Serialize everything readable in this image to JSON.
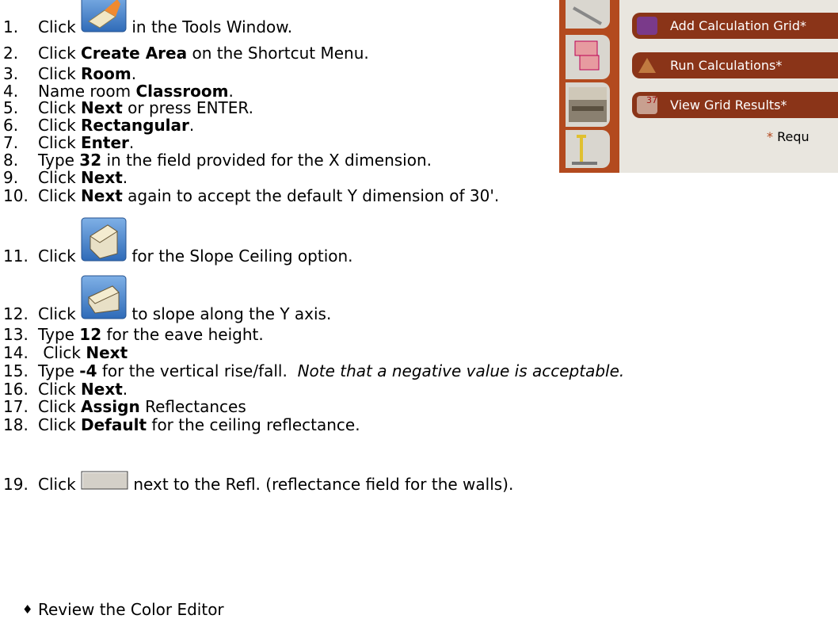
{
  "panel": {
    "buttons": [
      "Add Calculation Grid*",
      "Run Calculations*",
      "View Grid Results*"
    ],
    "grid_badge": "37",
    "required_star": "*",
    "required_text": "Requ"
  },
  "steps": [
    {
      "num": "1.",
      "pre": "Click ",
      "icon": "create-area-tool-icon",
      "post": " in the Tools Window."
    },
    {
      "num": "2.",
      "pre": "Click ",
      "bold": "Create Area",
      "post": " on the Shortcut Menu."
    },
    {
      "num": "3.",
      "pre": "Click ",
      "bold": "Room",
      "post": "."
    },
    {
      "num": "4.",
      "pre": "Name room ",
      "bold": "Classroom",
      "post": "."
    },
    {
      "num": "5.",
      "pre": "Click ",
      "bold": "Next",
      "post": " or press ENTER."
    },
    {
      "num": "6.",
      "pre": "Click ",
      "bold": "Rectangular",
      "post": "."
    },
    {
      "num": "7.",
      "pre": "Click ",
      "bold": "Enter",
      "post": "."
    },
    {
      "num": "8.",
      "pre": "Type ",
      "bold": "32",
      "post": " in the field provided for the X dimension."
    },
    {
      "num": "9.",
      "pre": "Click ",
      "bold": "Next",
      "post": "."
    },
    {
      "num": "10.",
      "pre": "Click ",
      "bold": "Next",
      "post": " again to accept the default Y dimension of 30'."
    },
    {
      "num": "11.",
      "pre": "Click ",
      "icon": "slope-ceiling-icon",
      "post": " for the Slope Ceiling option."
    },
    {
      "num": "12.",
      "pre": "Click ",
      "icon": "slope-y-axis-icon",
      "post": " to slope along the Y axis."
    },
    {
      "num": "13.",
      "pre": "Type ",
      "bold": "12",
      "post": " for the eave height."
    },
    {
      "num": "14.",
      "pre": " Click ",
      "bold": "Next",
      "post": ""
    },
    {
      "num": "15.",
      "pre": "Type ",
      "bold": "-4",
      "post": " for the vertical rise/fall.  ",
      "italic": "Note that a negative value is acceptable."
    },
    {
      "num": "16.",
      "pre": "Click ",
      "bold": "Next",
      "post": "."
    },
    {
      "num": "17.",
      "pre": "Click ",
      "bold": "Assign",
      "post": " Reflectances"
    },
    {
      "num": "18.",
      "pre": "Click ",
      "bold": "Default",
      "post": " for the ceiling reflectance."
    },
    {
      "num": "19.",
      "pre": "Click ",
      "icon": "blank-color-button",
      "post": " next to the Refl. (reflectance field for the walls)."
    }
  ],
  "bullet": {
    "symbol": "♦",
    "text": "Review the Color Editor"
  }
}
